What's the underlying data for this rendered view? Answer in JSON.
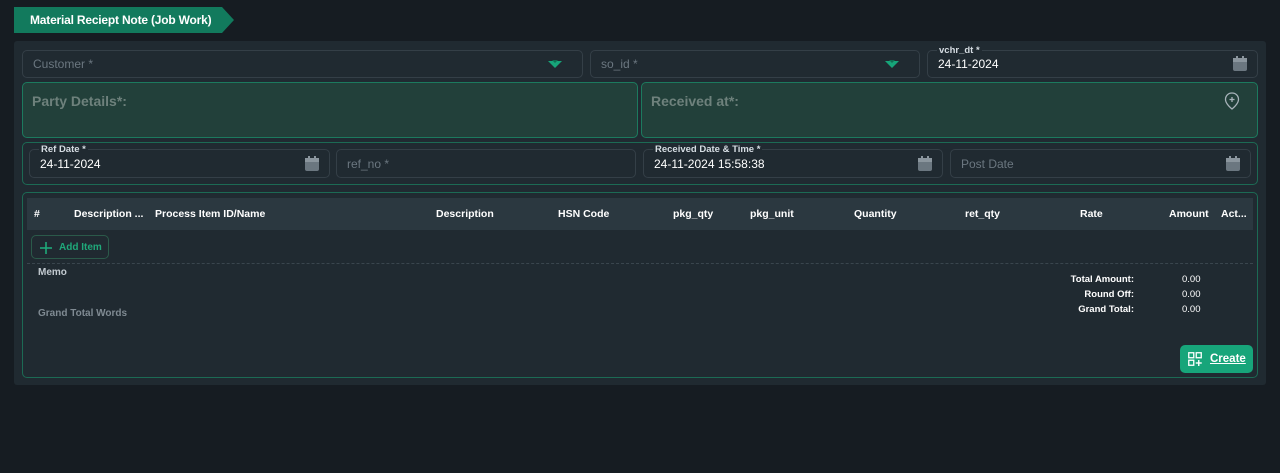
{
  "title": "Material Reciept Note (Job Work)",
  "header": {
    "customer": {
      "placeholder": "Customer *"
    },
    "so_id": {
      "placeholder": "so_id *"
    },
    "vchr_dt": {
      "label": "vchr_dt *",
      "value": "24-11-2024"
    }
  },
  "party_details": {
    "label": "Party Details*:"
  },
  "received_at": {
    "label": "Received at*:"
  },
  "ref_row": {
    "ref_date": {
      "label": "Ref Date *",
      "value": "24-11-2024"
    },
    "ref_no": {
      "placeholder": "ref_no *"
    },
    "received_datetime": {
      "label": "Received Date & Time *",
      "value": "24-11-2024 15:58:38"
    },
    "post_date": {
      "placeholder": "Post Date"
    }
  },
  "table": {
    "columns": [
      "#",
      "Description ...",
      "Process Item ID/Name",
      "Description",
      "HSN Code",
      "pkg_qty",
      "pkg_unit",
      "Quantity",
      "ret_qty",
      "Rate",
      "Amount",
      "Act..."
    ]
  },
  "add_item_label": "Add Item",
  "memo_label": "Memo",
  "grand_total_words_label": "Grand Total Words",
  "totals": [
    {
      "label": "Total Amount:",
      "value": "0.00"
    },
    {
      "label": "Round Off:",
      "value": "0.00"
    },
    {
      "label": "Grand Total:",
      "value": "0.00"
    }
  ],
  "create_label": "Create",
  "colors": {
    "accent": "#17a57a",
    "background": "#161c22",
    "card": "#202a31"
  }
}
